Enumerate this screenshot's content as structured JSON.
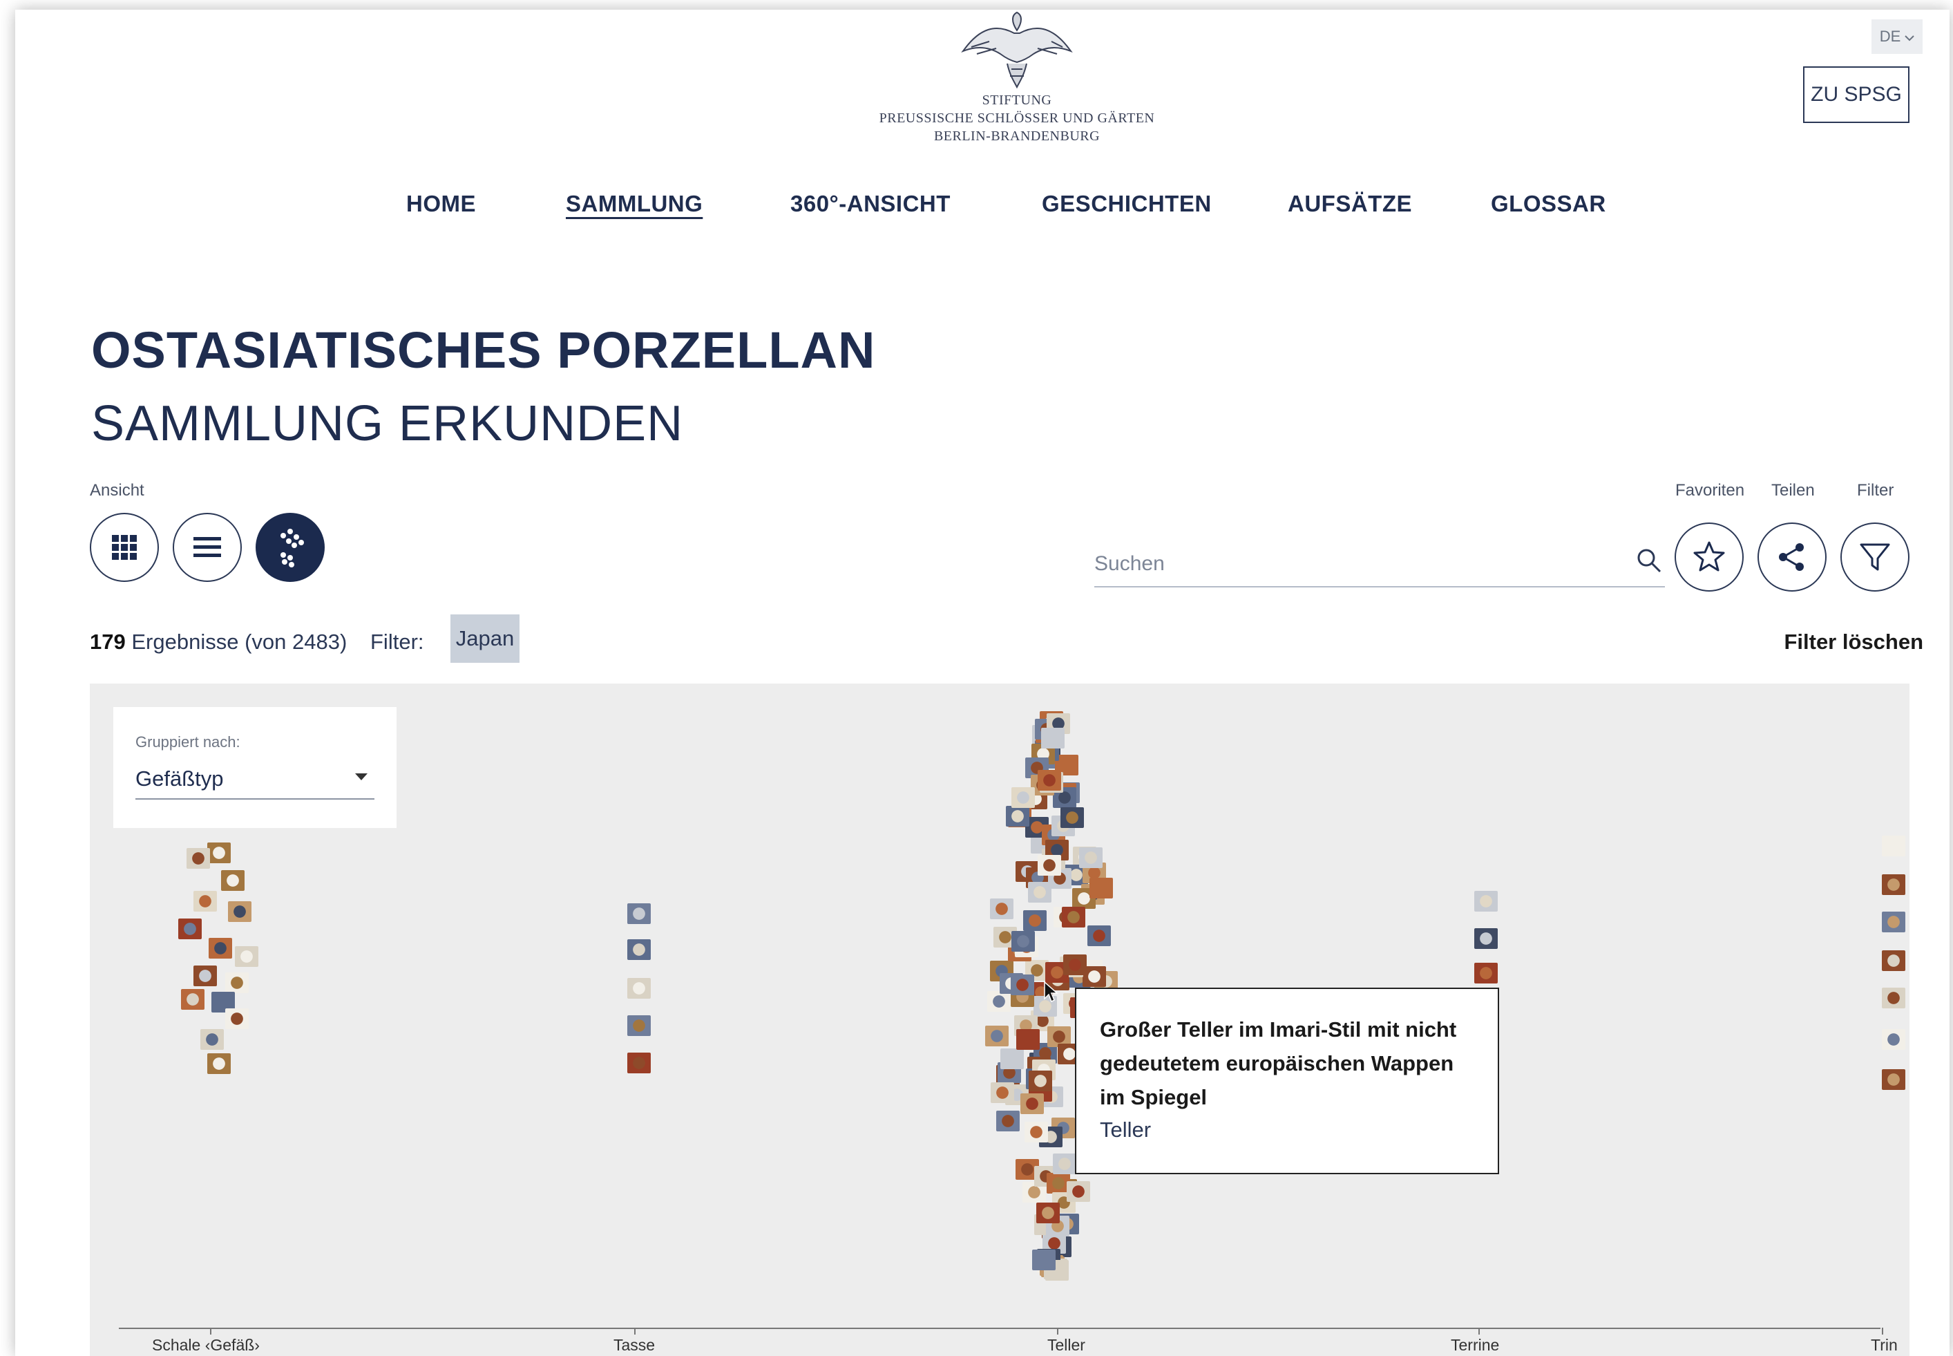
{
  "header": {
    "language": "DE",
    "logo_lines": [
      "STIFTUNG",
      "PREUSSISCHE SCHLÖSSER UND GÄRTEN",
      "BERLIN-BRANDENBURG"
    ],
    "spsg_button": "ZU SPSG"
  },
  "nav": {
    "items": [
      {
        "label": "HOME",
        "active": false
      },
      {
        "label": "SAMMLUNG",
        "active": true
      },
      {
        "label": "360°-ANSICHT",
        "active": false
      },
      {
        "label": "GESCHICHTEN",
        "active": false
      },
      {
        "label": "AUFSÄTZE",
        "active": false
      },
      {
        "label": "GLOSSAR",
        "active": false
      }
    ]
  },
  "page": {
    "title": "OSTASIATISCHES PORZELLAN",
    "subtitle": "SAMMLUNG ERKUNDEN"
  },
  "toolbar": {
    "view_label": "Ansicht",
    "views": [
      {
        "name": "grid",
        "icon": "grid-icon",
        "active": false
      },
      {
        "name": "list",
        "icon": "list-icon",
        "active": false
      },
      {
        "name": "cluster",
        "icon": "cluster-icon",
        "active": true
      }
    ],
    "search_placeholder": "Suchen",
    "favorites_label": "Favoriten",
    "share_label": "Teilen",
    "filter_label": "Filter"
  },
  "results": {
    "count": "179",
    "total_text": "Ergebnisse (von 2483)",
    "filter_label": "Filter:",
    "active_filter": "Japan",
    "clear_label": "Filter löschen"
  },
  "visualization": {
    "group_label": "Gruppiert nach:",
    "group_value": "Gefäßtyp",
    "axis_labels": [
      "Schale ‹Gefäß›",
      "Tasse",
      "Teller",
      "Terrine",
      "Trin"
    ],
    "tooltip": {
      "title": "Großer Teller im Imari-Stil mit nicht gedeutetem europäischen Wappen im Spiegel",
      "type": "Teller"
    }
  },
  "colors": {
    "navy": "#1b2a4e",
    "text": "#1f2d4f",
    "viz_bg": "#ededed",
    "chip_bg": "#c9d0da"
  }
}
